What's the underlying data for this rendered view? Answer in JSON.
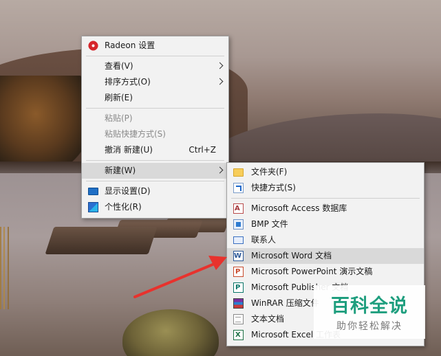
{
  "main_menu": {
    "items": [
      {
        "label": "Radeon 设置",
        "icon": "radeon-icon"
      },
      {
        "label": "查看(V)",
        "submenu": true
      },
      {
        "label": "排序方式(O)",
        "submenu": true
      },
      {
        "label": "刷新(E)"
      },
      {
        "label": "粘贴(P)",
        "disabled": true
      },
      {
        "label": "粘贴快捷方式(S)",
        "disabled": true
      },
      {
        "label": "撤消 新建(U)",
        "shortcut": "Ctrl+Z"
      },
      {
        "label": "新建(W)",
        "submenu": true,
        "highlighted": true
      },
      {
        "label": "显示设置(D)",
        "icon": "display-icon"
      },
      {
        "label": "个性化(R)",
        "icon": "personalize-icon"
      }
    ]
  },
  "new_submenu": {
    "items": [
      {
        "label": "文件夹(F)",
        "icon": "folder-icon"
      },
      {
        "label": "快捷方式(S)",
        "icon": "shortcut-icon"
      },
      {
        "label": "Microsoft Access 数据库",
        "icon": "access-icon"
      },
      {
        "label": "BMP 文件",
        "icon": "bmp-icon"
      },
      {
        "label": "联系人",
        "icon": "contact-icon"
      },
      {
        "label": "Microsoft Word 文档",
        "icon": "word-icon",
        "highlighted": true
      },
      {
        "label": "Microsoft PowerPoint 演示文稿",
        "icon": "powerpoint-icon"
      },
      {
        "label": "Microsoft Publisher 文档",
        "icon": "publisher-icon"
      },
      {
        "label": "WinRAR 压缩文件",
        "icon": "winrar-icon"
      },
      {
        "label": "文本文档",
        "icon": "text-document-icon"
      },
      {
        "label": "Microsoft Excel 工作表",
        "icon": "excel-icon"
      }
    ]
  },
  "watermark": {
    "title": "百科全说",
    "subtitle": "助你轻松解决"
  },
  "colors": {
    "menu_bg": "#f2f2f2",
    "highlight": "#d9d9d9",
    "pointer_arrow": "#e8322d",
    "watermark_green": "#1e9e7e"
  }
}
